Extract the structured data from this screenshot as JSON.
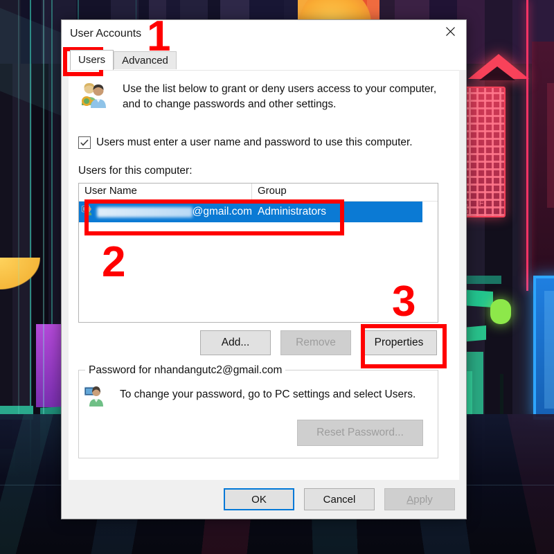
{
  "window": {
    "title": "User Accounts",
    "close_icon": "close-icon"
  },
  "tabs": [
    {
      "label": "Users",
      "active": true
    },
    {
      "label": "Advanced",
      "active": false
    }
  ],
  "panel": {
    "description": "Use the list below to grant or deny users access to your computer, and to change passwords and other settings.",
    "users_icon": "users-key-icon",
    "checkbox": {
      "label": "Users must enter a user name and password to use this computer.",
      "checked": true,
      "check_glyph": "✓"
    },
    "list_label": "Users for this computer:",
    "list": {
      "columns": [
        "User Name",
        "Group"
      ],
      "rows": [
        {
          "user_name_redacted": true,
          "user_name_suffix": "@gmail.com",
          "group": "Administrators",
          "selected": true,
          "icon": "user-account-icon"
        }
      ]
    },
    "buttons": [
      {
        "label": "Add...",
        "enabled": true
      },
      {
        "label": "Remove",
        "enabled": false
      },
      {
        "label": "Properties",
        "enabled": true
      }
    ],
    "password_group": {
      "legend": "Password for nhandangutc2@gmail.com",
      "icon": "user-monitor-icon",
      "text": "To change your password, go to PC settings and select Users.",
      "reset_button": {
        "label": "Reset Password...",
        "enabled": false
      }
    }
  },
  "footer": {
    "ok": "OK",
    "cancel": "Cancel",
    "apply_accel": "A",
    "apply_rest": "pply",
    "apply_enabled": false
  },
  "annotations": [
    {
      "number": "1",
      "target": "users-tab"
    },
    {
      "number": "2",
      "target": "user-list-row"
    },
    {
      "number": "3",
      "target": "properties-button"
    }
  ],
  "colors": {
    "accent_selection": "#0b7ad4",
    "focus_ring": "#0078d7",
    "annotation_red": "#ff0000",
    "dialog_bg": "#f0f0f0",
    "panel_bg": "#ffffff"
  }
}
